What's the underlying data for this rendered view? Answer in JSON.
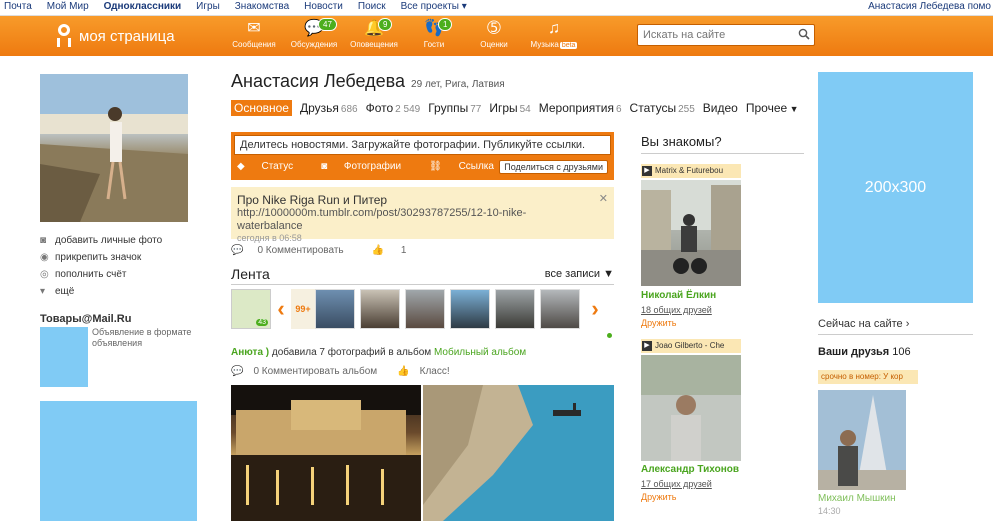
{
  "topbar": {
    "links": [
      "Почта",
      "Мой Мир",
      "Одноклассники",
      "Игры",
      "Знакомства",
      "Новости",
      "Поиск",
      "Все проекты ▾"
    ],
    "user": "Анастасия Лебедева",
    "user_suffix": "помо"
  },
  "header": {
    "logo_text": "моя страница",
    "nav": [
      {
        "icon": "envelope-icon",
        "label": "Сообщения",
        "badge": ""
      },
      {
        "icon": "chat-bubbles-icon",
        "label": "Обсуждения",
        "badge": "47"
      },
      {
        "icon": "bell-icon",
        "label": "Оповещения",
        "badge": "9"
      },
      {
        "icon": "footprints-icon",
        "label": "Гости",
        "badge": "1"
      },
      {
        "icon": "rating-icon",
        "label": "Оценки",
        "badge": ""
      },
      {
        "icon": "music-note-icon",
        "label": "Музыка",
        "badge": ""
      }
    ],
    "music_beta": "beta",
    "search_placeholder": "Искать на сайте"
  },
  "left": {
    "menu": [
      "добавить личные фото",
      "прикрепить значок",
      "пополнить счёт",
      "ещё"
    ],
    "goods_title": "Товары@Mail.Ru",
    "goods_text": "Объявление в формате объявления"
  },
  "profile": {
    "name": "Анастасия Лебедева",
    "info": "29 лет, Рига, Латвия",
    "tabs": [
      {
        "label": "Основное",
        "count": ""
      },
      {
        "label": "Друзья",
        "count": "686"
      },
      {
        "label": "Фото",
        "count": "2 549"
      },
      {
        "label": "Группы",
        "count": "77"
      },
      {
        "label": "Игры",
        "count": "54"
      },
      {
        "label": "Мероприятия",
        "count": "6"
      },
      {
        "label": "Статусы",
        "count": "255"
      },
      {
        "label": "Видео",
        "count": ""
      },
      {
        "label": "Прочее",
        "count": ""
      }
    ]
  },
  "share": {
    "prompt": "Делитесь новостями. Загружайте фотографии. Публикуйте ссылки.",
    "actions": [
      "Статус",
      "Фотографии",
      "Ссылка"
    ],
    "button": "Поделиться с друзьями"
  },
  "post": {
    "title": "Про Nike Riga Run и Питер",
    "url": "http://1000000m.tumblr.com/post/30293787255/12-10-nike-waterbalance",
    "time": "сегодня в 06:58",
    "comments": "0 Комментировать",
    "likes": "1"
  },
  "feed": {
    "title": "Лента",
    "all": "все записи ▼",
    "strip_badge": "43",
    "strip_more": "99+",
    "activity_user": "Анюта )",
    "activity_text": "добавила 7 фотографий в альбом",
    "activity_album": "Мобильный альбом",
    "activity_comment": "0 Комментировать альбом",
    "activity_like": "Класс!"
  },
  "knows": {
    "title": "Вы знакомы?",
    "cards": [
      {
        "tag": "Matrix & Futurebou",
        "name": "Николай Ёлкин",
        "mutual": "18 общих друзей",
        "add": "Дружить"
      },
      {
        "tag": "Joao Gilberto - Che",
        "name": "Александр Тихонов",
        "mutual": "17 общих друзей",
        "add": "Дружить"
      }
    ]
  },
  "right": {
    "ad_label": "200x300",
    "now_online": "Сейчас на сайте ›",
    "friends_title": "Ваши друзья",
    "friends_count": "106",
    "friend_tag": "срочно в номер: У кор",
    "friend_name": "Михаил Мышкин",
    "friend_time": "14:30"
  },
  "colors": {
    "brand_orange": "#ee7a10",
    "green": "#4cae1d",
    "ad_blue": "#80cbf5"
  }
}
